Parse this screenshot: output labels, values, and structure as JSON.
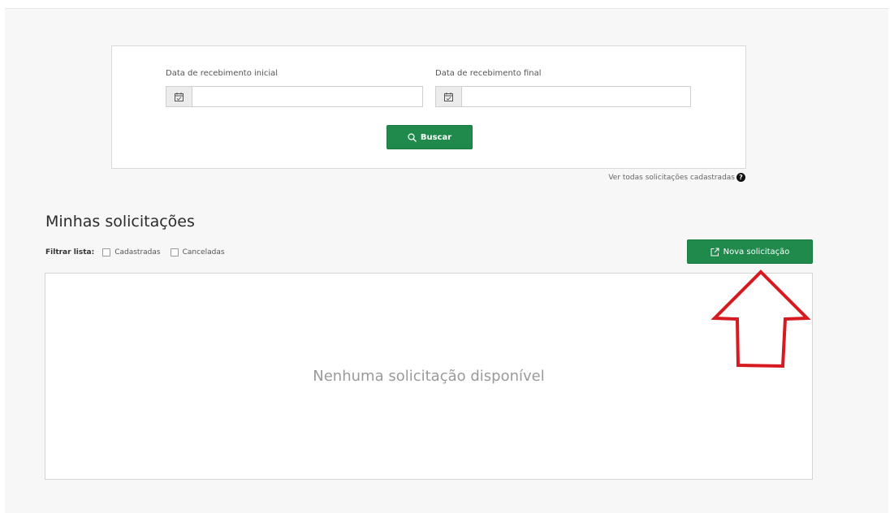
{
  "filters": {
    "start_date": {
      "label": "Data de recebimento inicial",
      "value": "",
      "icon": "calendar-icon"
    },
    "end_date": {
      "label": "Data de recebimento final",
      "value": "",
      "icon": "calendar-icon"
    },
    "search_button": {
      "label": "Buscar",
      "icon": "search-icon"
    },
    "see_all_link": "Ver todas solicitações cadastradas",
    "help_icon": "?"
  },
  "requests": {
    "title": "Minhas solicitações",
    "filter_label": "Filtrar lista:",
    "filter_options": [
      {
        "label": "Cadastradas",
        "checked": false
      },
      {
        "label": "Canceladas",
        "checked": false
      }
    ],
    "new_button": {
      "label": "Nova solicitação",
      "icon": "external-link-icon"
    },
    "empty_message": "Nenhuma solicitação disponível"
  },
  "colors": {
    "primary_green": "#1f8a4c",
    "annotation_red": "#d71920"
  }
}
